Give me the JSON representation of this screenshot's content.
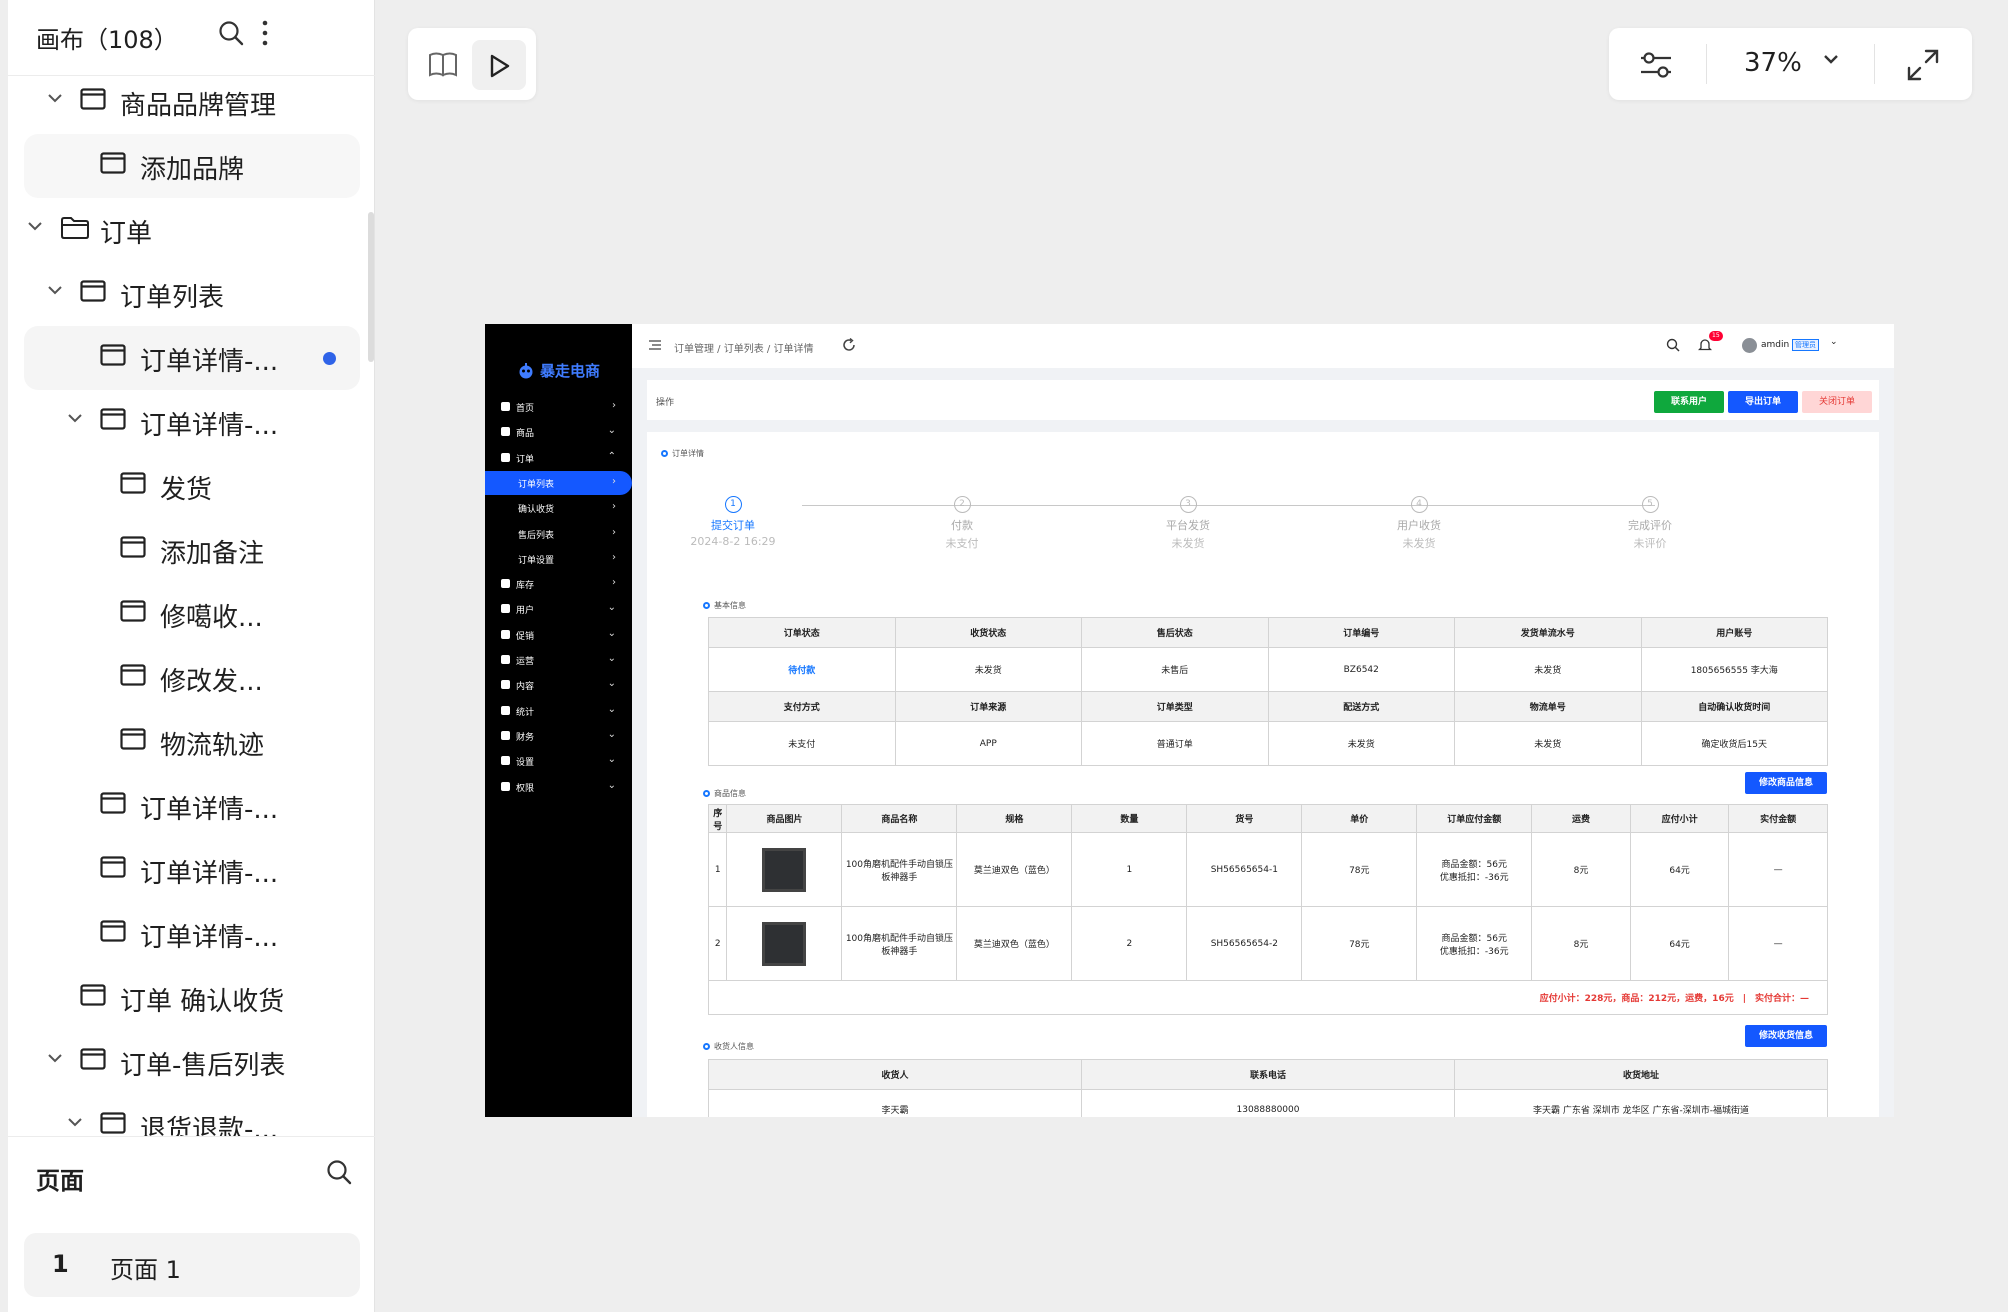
{
  "sidebar": {
    "title": "画布（108）",
    "tree": [
      {
        "label": "商品品牌管理",
        "icon": "frame",
        "chevron": true
      },
      {
        "label": "添加品牌",
        "icon": "frame",
        "chevron": false
      },
      {
        "label": "订单",
        "icon": "folder",
        "chevron": true
      },
      {
        "label": "订单列表",
        "icon": "frame",
        "chevron": true
      },
      {
        "label": "订单详情-...",
        "icon": "frame",
        "chevron": false,
        "selected": true
      },
      {
        "label": "订单详情-...",
        "icon": "frame",
        "chevron": true
      },
      {
        "label": "发货",
        "icon": "frame",
        "chevron": false
      },
      {
        "label": "添加备注",
        "icon": "frame",
        "chevron": false
      },
      {
        "label": "修噶收...",
        "icon": "frame",
        "chevron": false
      },
      {
        "label": "修改发...",
        "icon": "frame",
        "chevron": false
      },
      {
        "label": "物流轨迹",
        "icon": "frame",
        "chevron": false
      },
      {
        "label": "订单详情-...",
        "icon": "frame",
        "chevron": false
      },
      {
        "label": "订单详情-...",
        "icon": "frame",
        "chevron": false
      },
      {
        "label": "订单详情-...",
        "icon": "frame",
        "chevron": false
      },
      {
        "label": "订单 确认收货",
        "icon": "frame",
        "chevron": false
      },
      {
        "label": "订单-售后列表",
        "icon": "frame",
        "chevron": true
      },
      {
        "label": "退货退款-...",
        "icon": "frame",
        "chevron": true
      }
    ],
    "pages_title": "页面",
    "page_item": {
      "num": "1",
      "label": "页面 1"
    }
  },
  "toolbar": {
    "zoom": "37%"
  },
  "preview": {
    "logo": "暴走电商",
    "menu": [
      {
        "label": "首页",
        "arrow": "›",
        "type": "top"
      },
      {
        "label": "商品",
        "arrow": "⌄",
        "type": "top"
      },
      {
        "label": "订单",
        "arrow": "⌃",
        "type": "top"
      },
      {
        "label": "订单列表",
        "arrow": "›",
        "type": "sub",
        "active": true
      },
      {
        "label": "确认收货",
        "arrow": "›",
        "type": "sub"
      },
      {
        "label": "售后列表",
        "arrow": "›",
        "type": "sub"
      },
      {
        "label": "订单设置",
        "arrow": "›",
        "type": "sub"
      },
      {
        "label": "库存",
        "arrow": "›",
        "type": "top"
      },
      {
        "label": "用户",
        "arrow": "⌄",
        "type": "top"
      },
      {
        "label": "促销",
        "arrow": "⌄",
        "type": "top"
      },
      {
        "label": "运营",
        "arrow": "⌄",
        "type": "top"
      },
      {
        "label": "内容",
        "arrow": "⌄",
        "type": "top"
      },
      {
        "label": "统计",
        "arrow": "⌄",
        "type": "top"
      },
      {
        "label": "财务",
        "arrow": "⌄",
        "type": "top"
      },
      {
        "label": "设置",
        "arrow": "⌄",
        "type": "top"
      },
      {
        "label": "权限",
        "arrow": "⌄",
        "type": "top"
      }
    ],
    "breadcrumb": "订单管理 / 订单列表 / 订单详情",
    "notif_count": "15",
    "user": "amdin",
    "role": "管理员",
    "ops_label": "操作",
    "btn_contact": "联系用户",
    "btn_export": "导出订单",
    "btn_close": "关闭订单",
    "section_detail": "订单详情",
    "steps": [
      {
        "n": "1",
        "title": "提交订单",
        "sub": "2024-8-2 16:29"
      },
      {
        "n": "2",
        "title": "付款",
        "sub": "未支付"
      },
      {
        "n": "3",
        "title": "平台发货",
        "sub": "未发货"
      },
      {
        "n": "4",
        "title": "用户收货",
        "sub": "未发货"
      },
      {
        "n": "5",
        "title": "完成评价",
        "sub": "未评价"
      }
    ],
    "section_basic": "基本信息",
    "basic_rows": [
      [
        "订单状态",
        "收货状态",
        "售后状态",
        "订单编号",
        "发货单流水号",
        "用户账号"
      ],
      [
        "待付款",
        "未发货",
        "未售后",
        "BZ6542",
        "未发货",
        "1805656555 李大海"
      ],
      [
        "支付方式",
        "订单来源",
        "订单类型",
        "配送方式",
        "物流单号",
        "自动确认收货时间"
      ],
      [
        "未支付",
        "APP",
        "普通订单",
        "未发货",
        "未发货",
        "确定收货后15天"
      ]
    ],
    "section_goods": "商品信息",
    "btn_edit_goods": "修改商品信息",
    "goods_headers": [
      "序号",
      "商品图片",
      "商品名称",
      "规格",
      "数量",
      "货号",
      "单价",
      "订单应付金额",
      "运费",
      "应付小计",
      "实付金额"
    ],
    "goods_rows": [
      {
        "idx": "1",
        "name": "100角磨机配件手动自锁压板神器手",
        "spec": "莫兰迪双色（蓝色）",
        "qty": "1",
        "sku": "SH56565654-1",
        "price": "78元",
        "pay1": "商品金额：56元",
        "pay2": "优惠抵扣：-36元",
        "freight": "8元",
        "subtotal": "64元",
        "paid": "—"
      },
      {
        "idx": "2",
        "name": "100角磨机配件手动自锁压板神器手",
        "spec": "莫兰迪双色（蓝色）",
        "qty": "2",
        "sku": "SH56565654-2",
        "price": "78元",
        "pay1": "商品金额：56元",
        "pay2": "优惠抵扣：-36元",
        "freight": "8元",
        "subtotal": "64元",
        "paid": "—"
      }
    ],
    "summary": "应付小计：228元，商品：212元，运费，16元　|　实付合计：—",
    "section_receiver": "收货人信息",
    "btn_edit_receiver": "修改收货信息",
    "receiver_headers": [
      "收货人",
      "联系电话",
      "收货地址"
    ],
    "receiver_row": [
      "李天霸",
      "13088880000",
      "李天霸 广东省 深圳市 龙华区 广东省-深圳市-福城街道"
    ]
  },
  "colors": {
    "primary": "#1458ff",
    "success": "#0fa83d",
    "danger_bg": "#ffd6d6",
    "danger_text": "#e53935",
    "sidebar_bg": "#000000"
  }
}
